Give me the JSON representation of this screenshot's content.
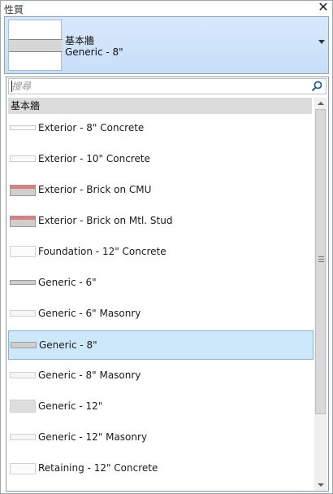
{
  "window": {
    "title": "性質",
    "close_glyph": "✕"
  },
  "selector": {
    "family": "基本牆",
    "type": "Generic - 8\""
  },
  "search": {
    "placeholder": "搜尋",
    "value": ""
  },
  "group": {
    "header": "基本牆"
  },
  "items": [
    {
      "label": "Exterior - 8\" Concrete",
      "swatch": "thin",
      "selected": false
    },
    {
      "label": "Exterior - 10\" Concrete",
      "swatch": "thin2",
      "selected": false
    },
    {
      "label": "Exterior - Brick on CMU",
      "swatch": "brick",
      "selected": false
    },
    {
      "label": "Exterior - Brick on Mtl. Stud",
      "swatch": "brick",
      "selected": false
    },
    {
      "label": "Foundation - 12\" Concrete",
      "swatch": "foundation",
      "selected": false
    },
    {
      "label": "Generic - 6\"",
      "swatch": "g6",
      "selected": false
    },
    {
      "label": "Generic - 6\" Masonry",
      "swatch": "masonry",
      "selected": false
    },
    {
      "label": "Generic - 8\"",
      "swatch": "g8",
      "selected": true
    },
    {
      "label": "Generic - 8\" Masonry",
      "swatch": "masonry",
      "selected": false
    },
    {
      "label": "Generic - 12\"",
      "swatch": "g12",
      "selected": false
    },
    {
      "label": "Generic - 12\" Masonry",
      "swatch": "masonry",
      "selected": false
    },
    {
      "label": "Retaining - 12\" Concrete",
      "swatch": "ret",
      "selected": false
    }
  ],
  "colors": {
    "selection_bg": "#cde8f8",
    "selection_border": "#7fb4dc",
    "selector_bg": "#c7def8",
    "brick": "#e37b7b"
  }
}
